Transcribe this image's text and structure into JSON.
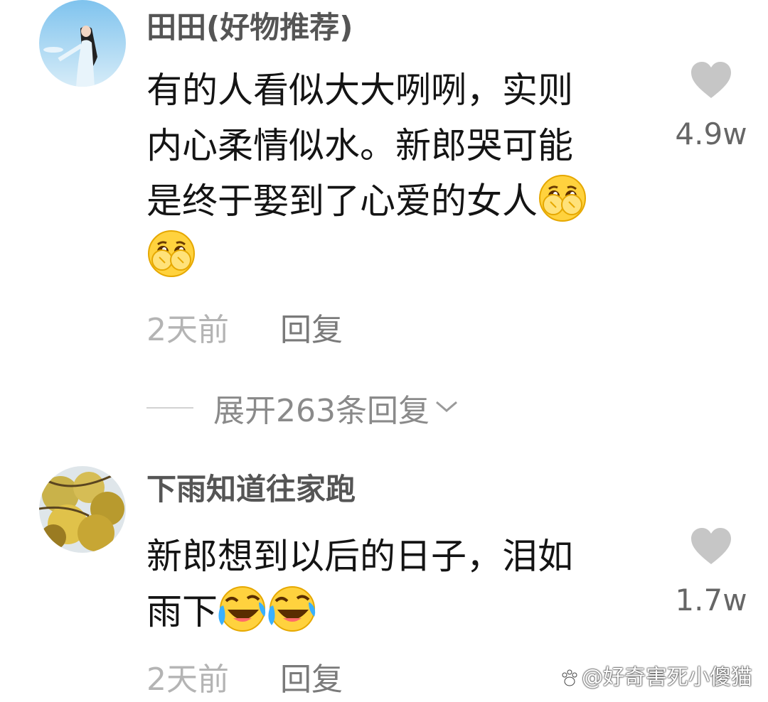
{
  "comments": [
    {
      "username": "田田(好物推荐)",
      "content_line1": "有的人看似大大咧咧，实则",
      "content_line2": "内心柔情似水。新郎哭可能",
      "content_line3": "是终于娶到了心爱的女人",
      "emoji": "pleading-cover-mouth-emoji",
      "likes": "4.9w",
      "time": "2天前",
      "reply_label": "回复",
      "expand_label": "展开263条回复"
    },
    {
      "username": "下雨知道往家跑",
      "content_line1": "新郎想到以后的日子，泪如",
      "content_line2": "雨下",
      "emoji": "laugh-crying-emoji",
      "likes": "1.7w",
      "time": "2天前",
      "reply_label": "回复"
    }
  ],
  "watermark": "@好奇害死小傻猫",
  "colors": {
    "heart": "#c6c6c6",
    "username": "#555555",
    "meta": "#b4b4b4"
  }
}
